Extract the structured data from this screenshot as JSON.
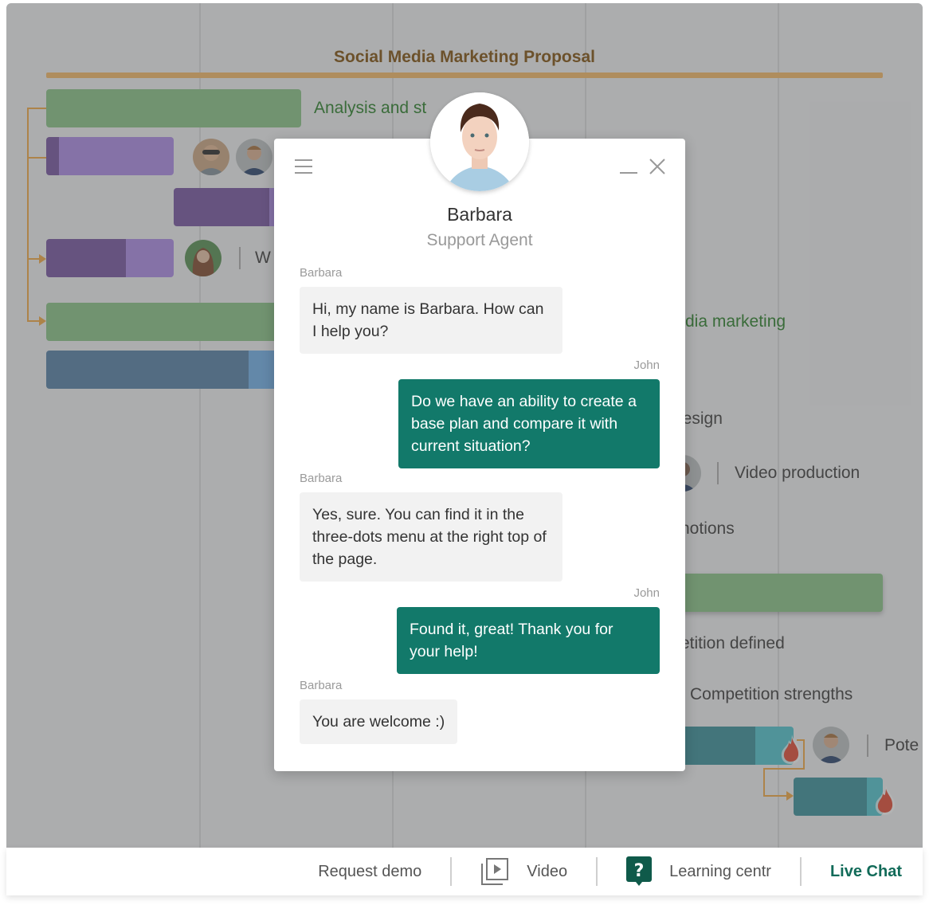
{
  "gantt": {
    "title": "Social Media Marketing Proposal",
    "tasks": [
      {
        "label": "Analysis and st"
      },
      {
        "label": "W"
      },
      {
        "label": "dia marketing"
      },
      {
        "label": "lesign"
      },
      {
        "label": "Video production"
      },
      {
        "label": "notions"
      },
      {
        "label": "etition defined"
      },
      {
        "label": "Competition strengths"
      },
      {
        "label": "Pote"
      }
    ],
    "colors": {
      "project": "#f5b661",
      "group": "#83c182",
      "purple": "#a885e6",
      "blue": "#6aaee9",
      "teal": "#48c1cc",
      "connector": "#f0a53b",
      "flame": "#e0432b"
    }
  },
  "chat": {
    "agent_name": "Barbara",
    "agent_role": "Support Agent",
    "messages": [
      {
        "sender": "Barbara",
        "text": "Hi, my name is Barbara. How can I help you?",
        "direction": "in"
      },
      {
        "sender": "John",
        "text": "Do we have an ability to create a base plan and compare it with current situation?",
        "direction": "out"
      },
      {
        "sender": "Barbara",
        "text": "Yes, sure. You can find it in the three-dots menu at the right top of the page.",
        "direction": "in"
      },
      {
        "sender": "John",
        "text": "Found it, great! Thank you for your help!",
        "direction": "out"
      },
      {
        "sender": "Barbara",
        "text": "You are welcome :)",
        "direction": "in"
      }
    ],
    "colors": {
      "outgoing": "#12796a",
      "incoming": "#f2f2f2"
    }
  },
  "bottom_bar": {
    "request_demo": "Request demo",
    "video": "Video",
    "learning": "Learning centr",
    "live_chat": "Live Chat",
    "accent": "#126b59"
  }
}
